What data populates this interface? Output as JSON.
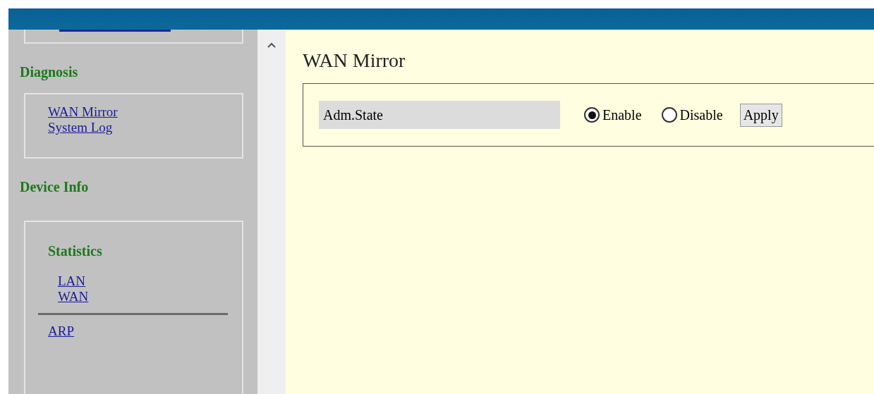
{
  "sidebar": {
    "sections": [
      {
        "title": "Diagnosis",
        "groups": [
          {
            "links": [
              "WAN Mirror",
              "System Log"
            ]
          }
        ]
      },
      {
        "title": "Device Info",
        "groups": [
          {
            "subtitle": "Statistics",
            "links": [
              "LAN",
              "WAN"
            ],
            "separator": true,
            "after_links": [
              "ARP"
            ]
          }
        ]
      }
    ]
  },
  "content": {
    "title": "WAN Mirror",
    "setting": {
      "label": "Adm.State",
      "options": [
        {
          "label": "Enable",
          "selected": true
        },
        {
          "label": "Disable",
          "selected": false
        }
      ],
      "button": "Apply"
    }
  }
}
